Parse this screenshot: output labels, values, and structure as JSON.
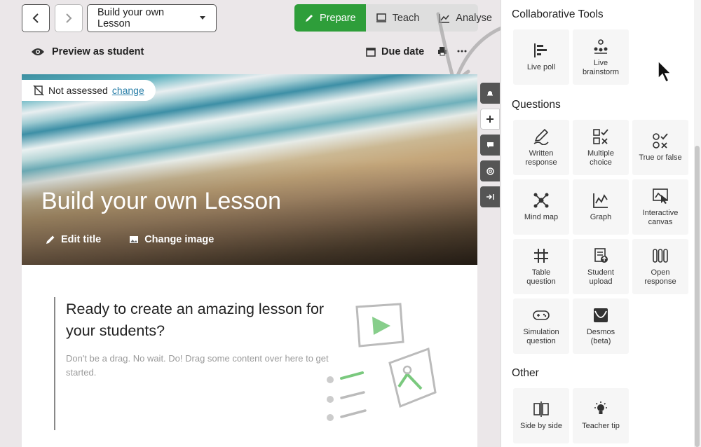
{
  "topbar": {
    "lesson_select": "Build your own Lesson",
    "modes": [
      {
        "label": "Prepare",
        "active": true
      },
      {
        "label": "Teach",
        "active": false
      },
      {
        "label": "Analyse",
        "active": false
      }
    ],
    "preview_label": "Preview as student",
    "due_date_label": "Due date"
  },
  "hero": {
    "assessment_status": "Not assessed",
    "assessment_link": "change",
    "title": "Build your own Lesson",
    "edit_title": "Edit title",
    "change_image": "Change image"
  },
  "card": {
    "heading": "Ready to create an amazing lesson for your students?",
    "subtext": "Don't be a drag. No wait. Do! Drag some content over here to get started."
  },
  "panel": {
    "collab_title": "Collaborative Tools",
    "collab": [
      {
        "label": "Live poll",
        "icon": "live-poll-icon"
      },
      {
        "label": "Live\nbrainstorm",
        "icon": "live-brainstorm-icon"
      }
    ],
    "questions_title": "Questions",
    "questions": [
      {
        "label": "Written\nresponse",
        "icon": "written-response-icon"
      },
      {
        "label": "Multiple\nchoice",
        "icon": "multiple-choice-icon"
      },
      {
        "label": "True or false",
        "icon": "true-false-icon"
      },
      {
        "label": "Mind map",
        "icon": "mind-map-icon"
      },
      {
        "label": "Graph",
        "icon": "graph-icon"
      },
      {
        "label": "Interactive\ncanvas",
        "icon": "interactive-canvas-icon"
      },
      {
        "label": "Table\nquestion",
        "icon": "table-icon"
      },
      {
        "label": "Student\nupload",
        "icon": "student-upload-icon"
      },
      {
        "label": "Open\nresponse",
        "icon": "open-response-icon"
      },
      {
        "label": "Simulation\nquestion",
        "icon": "simulation-icon"
      },
      {
        "label": "Desmos\n(beta)",
        "icon": "desmos-icon"
      }
    ],
    "other_title": "Other",
    "other": [
      {
        "label": "Side by side",
        "icon": "side-by-side-icon"
      },
      {
        "label": "Teacher tip",
        "icon": "teacher-tip-icon"
      }
    ]
  },
  "colors": {
    "accent": "#2e9e3a",
    "link": "#2a7fa8"
  }
}
